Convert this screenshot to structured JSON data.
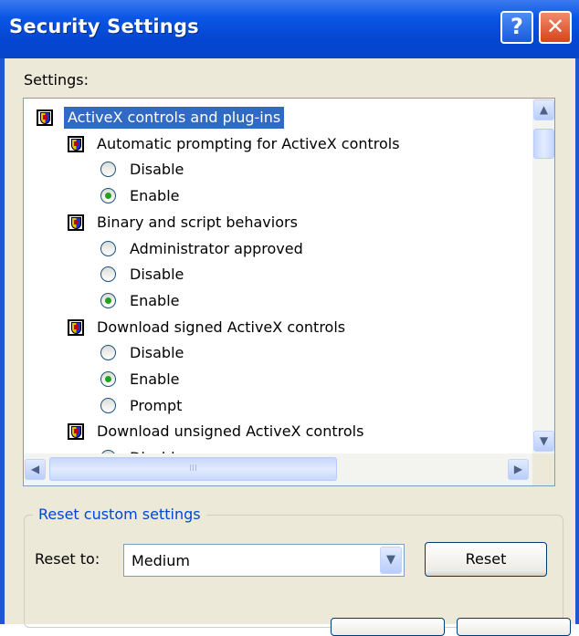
{
  "window": {
    "title": "Security Settings",
    "help_glyph": "?",
    "close_glyph": "✕"
  },
  "settings_label": "Settings:",
  "tree": {
    "category": "ActiveX controls and plug-ins",
    "groups": [
      {
        "label": "Automatic prompting for ActiveX controls",
        "options": [
          {
            "label": "Disable",
            "selected": false
          },
          {
            "label": "Enable",
            "selected": true
          }
        ]
      },
      {
        "label": "Binary and script behaviors",
        "options": [
          {
            "label": "Administrator approved",
            "selected": false
          },
          {
            "label": "Disable",
            "selected": false
          },
          {
            "label": "Enable",
            "selected": true
          }
        ]
      },
      {
        "label": "Download signed ActiveX controls",
        "options": [
          {
            "label": "Disable",
            "selected": false
          },
          {
            "label": "Enable",
            "selected": true
          },
          {
            "label": "Prompt",
            "selected": false
          }
        ]
      },
      {
        "label": "Download unsigned ActiveX controls",
        "options": [
          {
            "label": "Disable",
            "selected": false
          }
        ]
      }
    ]
  },
  "scrollbars": {
    "up_glyph": "▲",
    "down_glyph": "▼",
    "left_glyph": "◀",
    "right_glyph": "▶",
    "grip_glyph": "III"
  },
  "reset_group": {
    "legend": "Reset custom settings",
    "reset_to_label": "Reset to:",
    "selected_level": "Medium",
    "dropdown_glyph": "▼",
    "reset_button": "Reset"
  },
  "colors": {
    "titlebar": "#0545d0",
    "selection": "#316ac5",
    "radio_dot": "#21a121",
    "legend_text": "#0046d5"
  },
  "icons": {
    "category": "security-shield-icon",
    "radio": "radio-button"
  }
}
